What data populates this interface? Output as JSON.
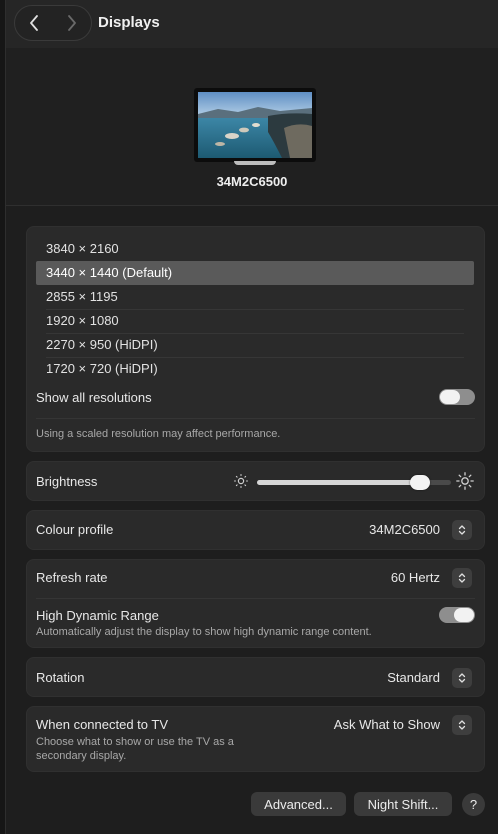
{
  "header": {
    "title": "Displays",
    "back_icon": "chevron-left-icon",
    "forward_icon": "chevron-right-icon"
  },
  "display": {
    "name": "34M2C6500"
  },
  "resolutions": {
    "options": [
      "3840 × 2160",
      "3440 × 1440 (Default)",
      "2855 × 1195",
      "1920 × 1080",
      "2270 × 950 (HiDPI)",
      "1720 × 720 (HiDPI)"
    ],
    "selected_index": 1,
    "show_all_label": "Show all resolutions",
    "show_all_enabled": false,
    "note": "Using a scaled resolution may affect performance."
  },
  "brightness": {
    "label": "Brightness",
    "level": 0.88
  },
  "colour_profile": {
    "label": "Colour profile",
    "value": "34M2C6500"
  },
  "refresh_rate": {
    "label": "Refresh rate",
    "value": "60 Hertz"
  },
  "hdr": {
    "label": "High Dynamic Range",
    "description": "Automatically adjust the display to show high dynamic range content.",
    "enabled": true
  },
  "rotation": {
    "label": "Rotation",
    "value": "Standard"
  },
  "tv": {
    "label": "When connected to TV",
    "description_line1": "Choose what to show or use the TV as a",
    "description_line2": "secondary display.",
    "value": "Ask What to Show"
  },
  "footer": {
    "advanced_label": "Advanced...",
    "night_shift_label": "Night Shift...",
    "help_label": "?"
  },
  "colors": {
    "background": "#1e1e1e",
    "card": "#2a2a2a",
    "selected_row": "#5a5a5a",
    "toggle_on": "#8e8e8e",
    "toggle_off": "#8e8e8e"
  }
}
